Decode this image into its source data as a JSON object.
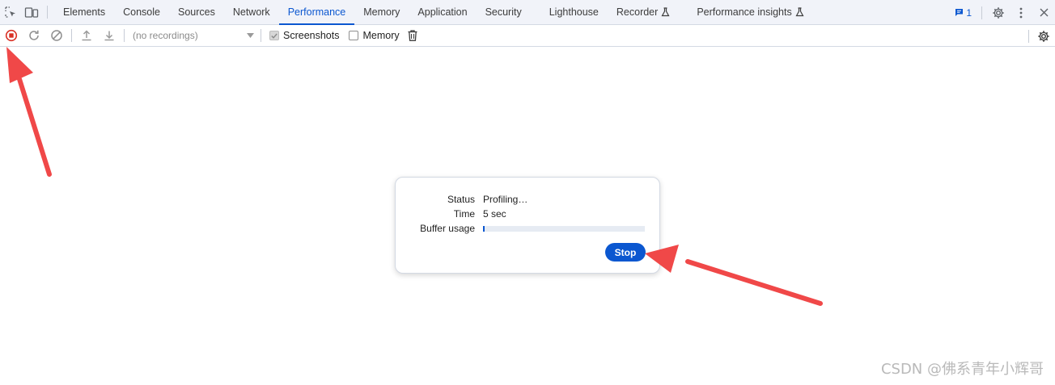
{
  "tabbar": {
    "tabs": [
      {
        "label": "Elements"
      },
      {
        "label": "Console"
      },
      {
        "label": "Sources"
      },
      {
        "label": "Network"
      },
      {
        "label": "Performance",
        "active": true
      },
      {
        "label": "Memory"
      },
      {
        "label": "Application"
      },
      {
        "label": "Security"
      },
      {
        "label": "Lighthouse"
      },
      {
        "label": "Recorder",
        "icon": "flask-icon"
      },
      {
        "label": "Performance insights",
        "icon": "flask-icon"
      }
    ],
    "issues_count": "1"
  },
  "toolbar": {
    "recordings_placeholder": "(no recordings)",
    "screenshots_label": "Screenshots",
    "screenshots_checked": true,
    "memory_label": "Memory",
    "memory_checked": false
  },
  "dialog": {
    "status_label": "Status",
    "status_value": "Profiling…",
    "time_label": "Time",
    "time_value": "5 sec",
    "buffer_label": "Buffer usage",
    "buffer_usage_fraction": 0.01,
    "stop_label": "Stop"
  },
  "watermark": "CSDN @佛系青年小辉哥",
  "colors": {
    "accent": "#0b57d0",
    "record_red": "#d93025",
    "annotation_arrow": "#f04848"
  }
}
